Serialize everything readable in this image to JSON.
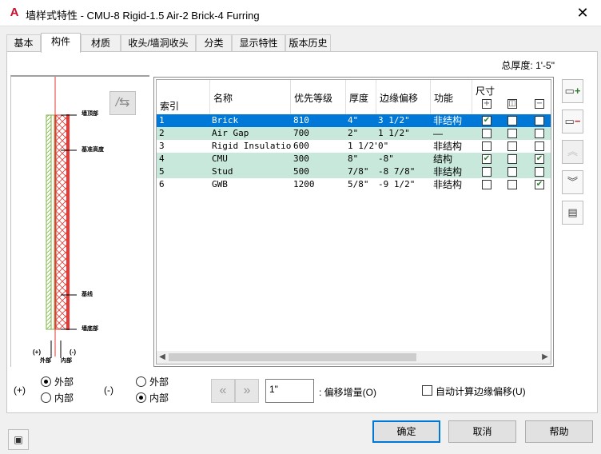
{
  "window": {
    "app_icon": "A",
    "title": "墙样式特性 - CMU-8 Rigid-1.5 Air-2 Brick-4 Furring",
    "close": "✕"
  },
  "tabs": [
    {
      "label": "基本",
      "active": false
    },
    {
      "label": "构件",
      "active": true
    },
    {
      "label": "材质",
      "active": false
    },
    {
      "label": "收头/墙洞收头",
      "active": false
    },
    {
      "label": "分类",
      "active": false
    },
    {
      "label": "显示特性",
      "active": false
    },
    {
      "label": "版本历史",
      "active": false
    }
  ],
  "total_thickness": "总厚度: 1'-5\"",
  "preview": {
    "flip_button": "/⇆",
    "labels": {
      "top": "墙顶部",
      "baseline": "基准高度",
      "base": "基线",
      "bottom": "墙底部",
      "exterior_sign": "(+)",
      "exterior": "外部",
      "interior_sign": "(-)",
      "interior": "内部"
    }
  },
  "table": {
    "headers": {
      "index": "索引",
      "name": "名称",
      "priority": "优先等级",
      "thickness": "厚度",
      "edge_offset": "边缘偏移",
      "function": "功能",
      "dimension": "尺寸"
    },
    "dimension_icons": [
      "plus-box-icon",
      "center-box-icon",
      "minus-box-icon"
    ],
    "dimension_glyphs": [
      "+",
      "◫",
      "−"
    ],
    "rows": [
      {
        "index": "1",
        "name": "Brick",
        "priority": "810",
        "thickness": "4\"",
        "offset": "3 1/2\"",
        "function": "非结构",
        "dims": [
          true,
          false,
          false
        ]
      },
      {
        "index": "2",
        "name": "Air Gap",
        "priority": "700",
        "thickness": "2\"",
        "offset": "1 1/2\"",
        "function": "—",
        "dims": [
          false,
          false,
          false
        ]
      },
      {
        "index": "3",
        "name": "Rigid Insulation",
        "priority": "600",
        "thickness": "1 1/2\"",
        "offset": "0\"",
        "function": "非结构",
        "dims": [
          false,
          false,
          false
        ]
      },
      {
        "index": "4",
        "name": "CMU",
        "priority": "300",
        "thickness": "8\"",
        "offset": "-8\"",
        "function": "结构",
        "dims": [
          true,
          false,
          true
        ]
      },
      {
        "index": "5",
        "name": "Stud",
        "priority": "500",
        "thickness": "7/8\"",
        "offset": "-8 7/8\"",
        "function": "非结构",
        "dims": [
          false,
          false,
          false
        ]
      },
      {
        "index": "6",
        "name": "GWB",
        "priority": "1200",
        "thickness": "5/8\"",
        "offset": "-9 1/2\"",
        "function": "非结构",
        "dims": [
          false,
          false,
          true
        ]
      }
    ],
    "selected_row": 0
  },
  "side_buttons": [
    "add-component-icon",
    "remove-component-icon",
    "move-up-icon",
    "move-down-icon",
    "component-list-icon"
  ],
  "positive": {
    "sign": "(+)",
    "options": [
      {
        "label": "外部",
        "checked": true
      },
      {
        "label": "内部",
        "checked": false
      }
    ]
  },
  "negative": {
    "sign": "(-)",
    "options": [
      {
        "label": "外部",
        "checked": false
      },
      {
        "label": "内部",
        "checked": true
      }
    ]
  },
  "offset": {
    "value": "1\"",
    "label": ": 偏移增量(O)"
  },
  "auto_offset": {
    "label": "自动计算边缘偏移(U)",
    "checked": false
  },
  "buttons": {
    "ok": "确定",
    "cancel": "取消",
    "help": "帮助"
  }
}
